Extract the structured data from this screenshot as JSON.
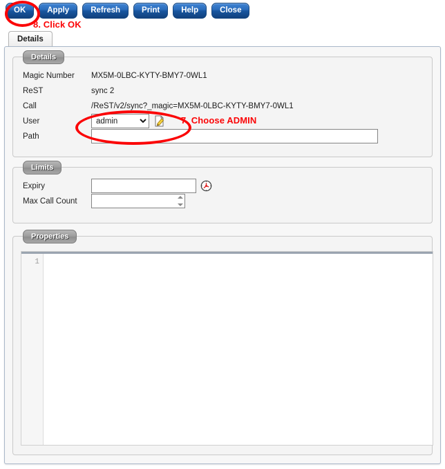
{
  "toolbar": {
    "buttons": [
      {
        "label": "OK",
        "name": "ok-button"
      },
      {
        "label": "Apply",
        "name": "apply-button"
      },
      {
        "label": "Refresh",
        "name": "refresh-button"
      },
      {
        "label": "Print",
        "name": "print-button"
      },
      {
        "label": "Help",
        "name": "help-button"
      },
      {
        "label": "Close",
        "name": "close-button"
      }
    ]
  },
  "annotations": {
    "step8": "8. Click OK",
    "step7": "7. Choose ADMIN",
    "color": "#fb0406"
  },
  "tabs": [
    {
      "label": "Details",
      "active": true
    }
  ],
  "details": {
    "legend": "Details",
    "fields": {
      "magic_number_label": "Magic Number",
      "magic_number_value": "MX5M-0LBC-KYTY-BMY7-0WL1",
      "rest_label": "ReST",
      "rest_value": "sync 2",
      "call_label": "Call",
      "call_value": "/ReST/v2/sync?_magic=MX5M-0LBC-KYTY-BMY7-0WL1",
      "user_label": "User",
      "user_value": "admin",
      "user_options": [
        "admin"
      ],
      "user_edit_icon": "edit-pencil-icon",
      "path_label": "Path",
      "path_value": "",
      "path_placeholder": ""
    }
  },
  "limits": {
    "legend": "Limits",
    "fields": {
      "expiry_label": "Expiry",
      "expiry_value": "",
      "expiry_placeholder": "",
      "expiry_icon": "clock-picker-icon",
      "max_call_count_label": "Max Call Count",
      "max_call_count_value": "",
      "max_call_count_placeholder": ""
    }
  },
  "properties": {
    "legend": "Properties",
    "line_numbers": [
      "1"
    ],
    "content": ""
  }
}
